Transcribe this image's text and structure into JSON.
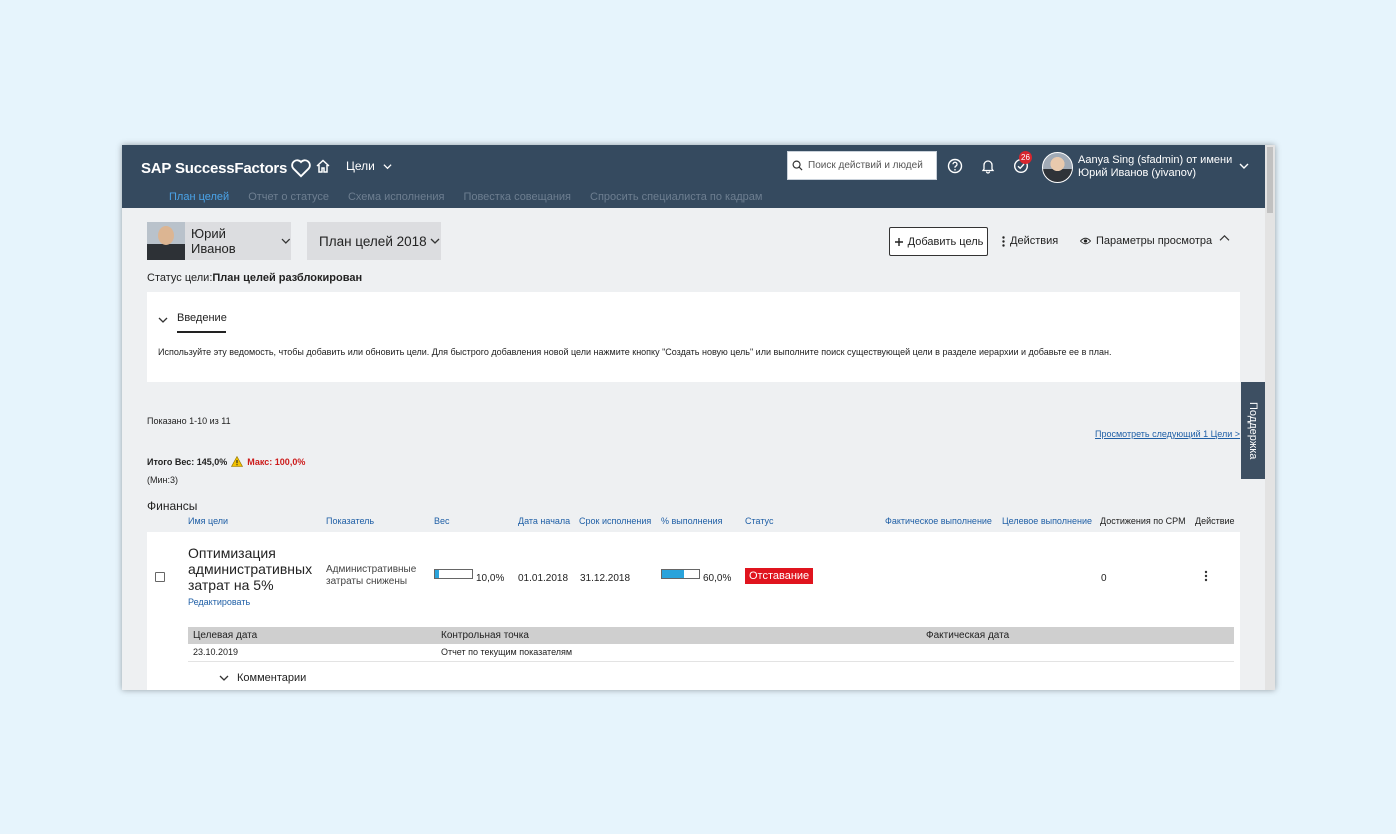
{
  "header": {
    "brand": "SAP SuccessFactors",
    "module": "Цели",
    "search_placeholder": "Поиск действий и людей",
    "notification_count": "26",
    "user_line1": "Aanya Sing (sfadmin) от имени",
    "user_line2": "Юрий Иванов (yivanov)"
  },
  "subtabs": [
    {
      "label": "План целей",
      "active": true
    },
    {
      "label": "Отчет о статусе",
      "active": false
    },
    {
      "label": "Схема исполнения",
      "active": false
    },
    {
      "label": "Повестка совещания",
      "active": false
    },
    {
      "label": "Спросить специалиста по кадрам",
      "active": false
    }
  ],
  "employee": {
    "name": "Юрий Иванов"
  },
  "plan": {
    "name": "План целей 2018"
  },
  "toolbar": {
    "add_goal": "Добавить цель",
    "actions": "Действия",
    "view_options": "Параметры просмотра"
  },
  "status_line": {
    "label": "Статус цели:",
    "value": "План целей разблокирован"
  },
  "intro": {
    "tab": "Введение",
    "text": "Используйте эту ведомость, чтобы добавить или обновить цели. Для быстрого добавления новой цели нажмите кнопку \"Создать новую цель\" или выполните поиск существующей цели в разделе иерархии и добавьте ее в план."
  },
  "support_tab": "Поддержка",
  "list": {
    "shown": "Показано 1-10 из 11",
    "next_link": "Просмотреть следующий 1 Цели >",
    "total_weight": "Итого Вес: 145,0%",
    "max": "Макс: 100,0%",
    "min": "(Мин:3)",
    "section": "Финансы"
  },
  "columns": {
    "name": "Имя цели",
    "metric": "Показатель",
    "weight": "Вес",
    "start": "Дата начала",
    "due": "Срок исполнения",
    "completion": "% выполнения",
    "status": "Статус",
    "actual": "Фактическое выполнение",
    "target": "Целевое выполнение",
    "cpm": "Достижения по CPM",
    "action": "Действие"
  },
  "goal": {
    "name": "Оптимизация административных затрат на 5%",
    "edit": "Редактировать",
    "metric": "Административные затраты снижены",
    "weight": "10,0%",
    "weight_fraction": 0.1,
    "start": "01.01.2018",
    "due": "31.12.2018",
    "completion": "60,0%",
    "completion_fraction": 0.6,
    "status": "Отставание",
    "cpm": "0",
    "status_color": "#e0141e"
  },
  "milestones": {
    "headers": [
      "Целевая дата",
      "Контрольная точка",
      "Фактическая дата"
    ],
    "rows": [
      [
        "23.10.2019",
        "Отчет по текущим показателям",
        ""
      ]
    ]
  },
  "comments_label": "Комментарии",
  "colors": {
    "topbar": "#354a5f",
    "link": "#1f5fa6",
    "active_tab": "#4aa3e8",
    "progress": "#2aa3db"
  }
}
